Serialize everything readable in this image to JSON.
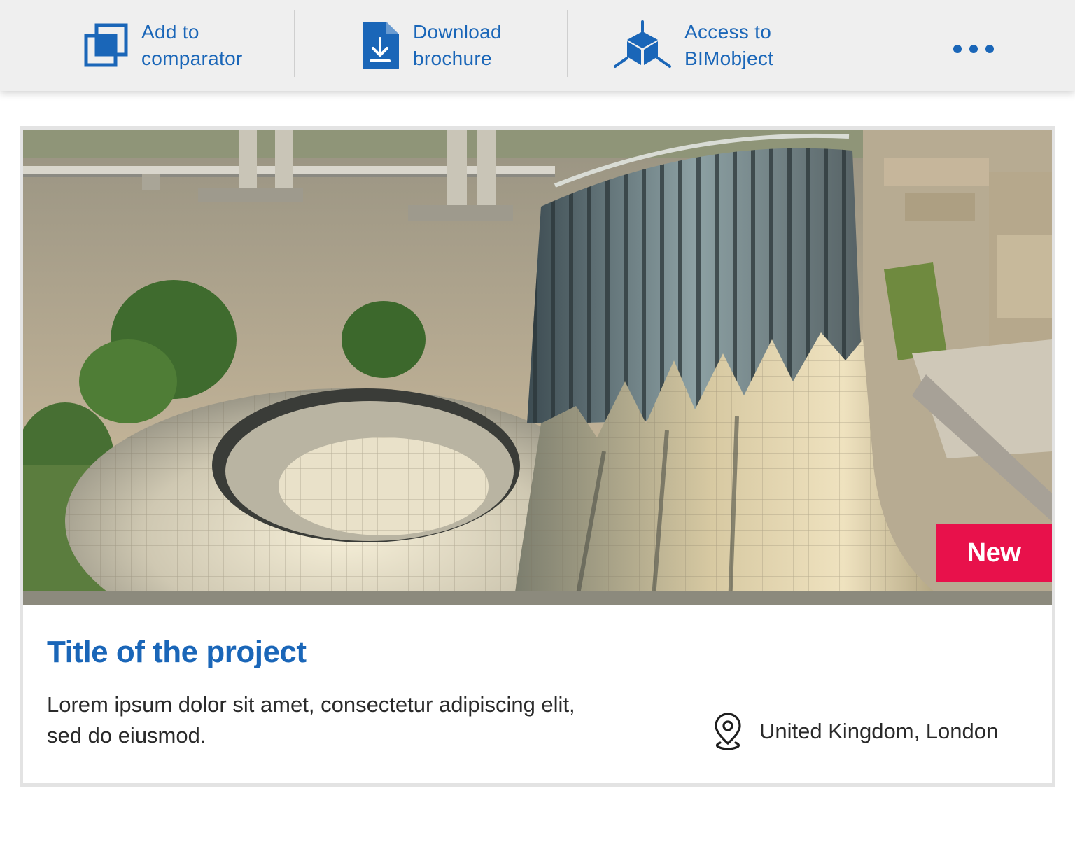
{
  "toolbar": {
    "compare": {
      "line1": "Add to",
      "line2": "comparator",
      "icon": "comparator-icon"
    },
    "brochure": {
      "line1": "Download",
      "line2": "brochure",
      "icon": "download-file-icon"
    },
    "bim": {
      "line1": "Access to",
      "line2": "BIMobject",
      "icon": "cube-icon"
    },
    "more": {
      "icon": "more-horizontal-icon"
    }
  },
  "card": {
    "image_alt": "Project photo",
    "badge": "New",
    "title": "Title of the project",
    "description": "Lorem ipsum dolor sit amet, consectetur adipiscing elit, sed do eiusmod.",
    "location": "United Kingdom, London",
    "location_icon": "map-pin-icon"
  },
  "colors": {
    "accent": "#1a66b8",
    "badge": "#e8114b",
    "toolbar_bg": "#efefef",
    "text": "#2a2a2a"
  }
}
